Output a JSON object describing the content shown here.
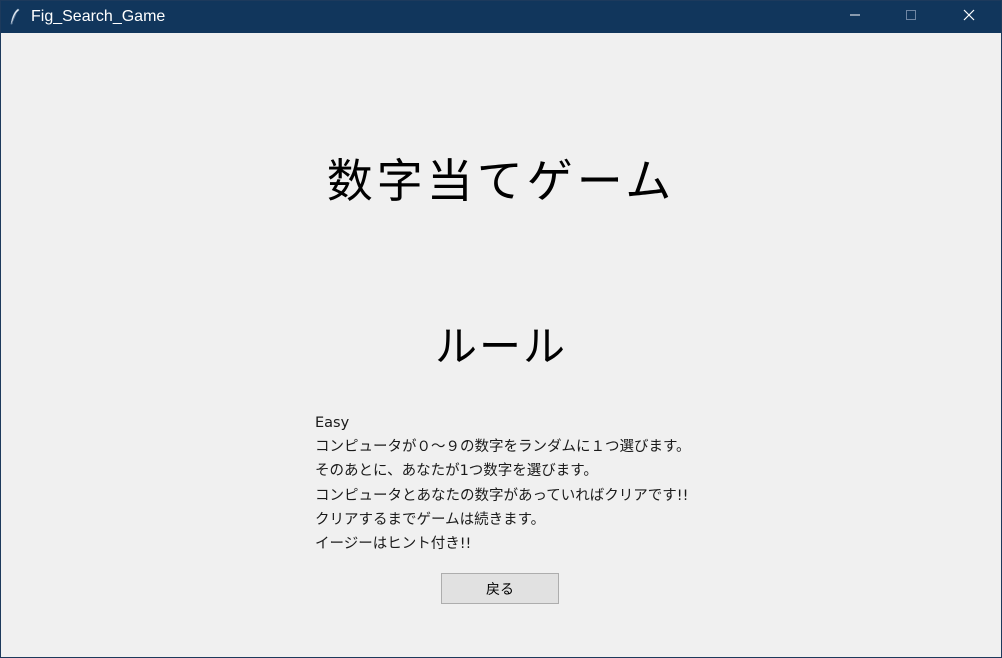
{
  "window": {
    "title": "Fig_Search_Game",
    "titlebar_color": "#11365c",
    "icon": "feather-icon",
    "controls": [
      "minimize-icon",
      "maximize-icon",
      "close-icon"
    ]
  },
  "main": {
    "title": "数字当てゲーム",
    "rules_title": "ルール",
    "rules_lines": [
      "Easy",
      "コンピュータが０～９の数字をランダムに１つ選びます。",
      "そのあとに、あなたが1つ数字を選びます。",
      "コンピュータとあなたの数字があっていればクリアです!!",
      "クリアするまでゲームは続きます。",
      "イージーはヒント付き!!"
    ],
    "back_button": "戻る"
  }
}
